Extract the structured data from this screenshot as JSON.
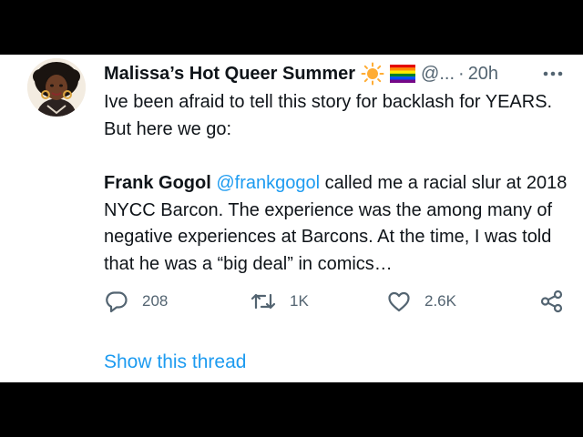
{
  "tweet": {
    "author_name": "Malissa’s Hot Queer Summer",
    "handle": "@...",
    "separator": "·",
    "time": "20h",
    "paragraph1": "Ive been afraid to tell this story for backlash for YEARS. But here we go:",
    "p2_name": "Frank Gogol",
    "p2_mention": "@frankgogol",
    "p2_text": " called me a racial slur at 2018 NYCC Barcon. The experience was the among many of negative experiences at Barcons. At the time, I was told that he was a “big deal” in comics…"
  },
  "actions": {
    "reply_count": "208",
    "retweet_count": "1K",
    "like_count": "2.6K"
  },
  "show_thread": "Show this thread",
  "colors": {
    "link": "#1d9bf0",
    "muted": "#536471",
    "text": "#0f1419"
  },
  "icons": [
    "sun-emoji-icon",
    "rainbow-flag-icon",
    "more-icon",
    "reply-icon",
    "retweet-icon",
    "like-icon",
    "share-icon"
  ]
}
